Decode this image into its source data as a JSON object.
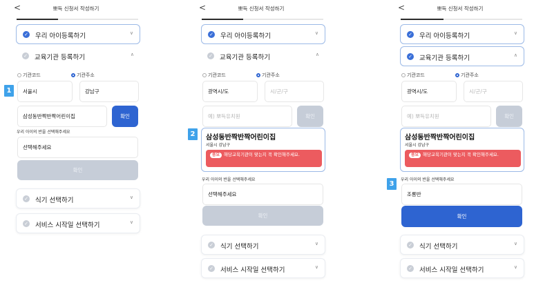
{
  "header": {
    "back_icon": "back-chevron-icon",
    "title": "뽀득 신청서 작성하기"
  },
  "sections": {
    "child": "우리 아이등록하기",
    "institution": "교육기관 등록하기",
    "meal": "식기 선택하기",
    "service": "서비스 시작일 선택하기"
  },
  "radio": {
    "code": "기관코드",
    "address": "기관주소"
  },
  "screen1": {
    "step": "1",
    "city": "서울시",
    "district": "강남구",
    "search_value": "삼성동반짝반짝어린이집",
    "confirm_search": "확인",
    "class_label": "우리 아이의 반을 선택해주세요",
    "class_select": "선택해주세요",
    "confirm": "확인"
  },
  "screen2": {
    "step": "2",
    "city_placeholder": "광역시/도",
    "district_placeholder": "시/군/구",
    "search_placeholder": "예) 뽀득유치원",
    "confirm_search": "확인",
    "result_name": "삼성동반짝반짝어린이집",
    "result_addr": "서울시 강남구",
    "warn_tag": "중요",
    "warn_text": "해당교육기관이 맞는지 꼭 확인해주세요.",
    "class_label": "우리 아이의 반을 선택해주세요",
    "class_select": "선택해주세요",
    "confirm": "확인"
  },
  "screen3": {
    "step": "3",
    "city_placeholder": "광역시/도",
    "district_placeholder": "시/군/구",
    "search_placeholder": "예) 뽀득유치원",
    "confirm_search": "확인",
    "result_name": "삼성동반짝반짝어린이집",
    "result_addr": "서울시 강남구",
    "warn_tag": "중요",
    "warn_text": "해당교육기관이 맞는지 꼭 확인해주세요.",
    "class_label": "우리 아이의 반을 선택해주세요",
    "class_value": "조롱반",
    "confirm": "확인"
  },
  "colors": {
    "primary": "#2e64d1",
    "warning": "#ec5b5f",
    "step_badge": "#3fa2ea",
    "disabled": "#c6cdd8"
  }
}
